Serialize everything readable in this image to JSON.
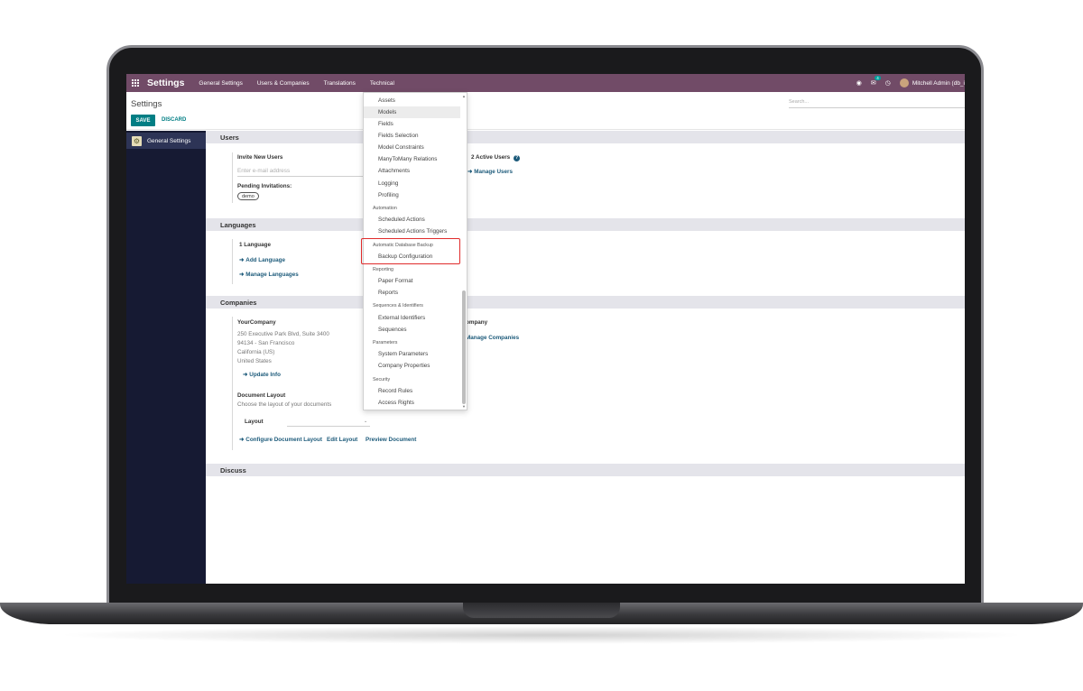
{
  "navbar": {
    "brand": "Settings",
    "menu": [
      "General Settings",
      "Users & Companies",
      "Translations",
      "Technical"
    ],
    "chat_badge": "4",
    "user": "Mitchell Admin (db_i"
  },
  "control": {
    "title": "Settings",
    "save": "SAVE",
    "discard": "DISCARD",
    "search_placeholder": "Search..."
  },
  "sidebar": {
    "items": [
      {
        "label": "General Settings"
      }
    ]
  },
  "sections": {
    "users": "Users",
    "languages": "Languages",
    "companies": "Companies",
    "discuss": "Discuss"
  },
  "users": {
    "invite_label": "Invite New Users",
    "email_placeholder": "Enter e-mail address",
    "pending_label": "Pending Invitations:",
    "pending_tag": "demo",
    "active_users": "2 Active Users",
    "manage_users": "Manage Users"
  },
  "languages": {
    "count": "1 Language",
    "add": "Add Language",
    "manage": "Manage Languages"
  },
  "companies": {
    "name": "YourCompany",
    "address": [
      "250 Executive Park Blvd, Suite 3400",
      "94134 - San Francisco",
      "California (US)",
      "United States"
    ],
    "update": "Update Info",
    "doc_layout_title": "Document Layout",
    "doc_layout_desc": "Choose the layout of your documents",
    "layout_label": "Layout",
    "configure": "Configure Document Layout",
    "edit_layout": "Edit Layout",
    "preview": "Preview Document",
    "company_partial": "ompany",
    "manage_companies": "Manage Companies"
  },
  "dropdown": {
    "items_top": [
      "Assets",
      "Models",
      "Fields",
      "Fields Selection",
      "Model Constraints",
      "ManyToMany Relations",
      "Attachments",
      "Logging",
      "Profiling"
    ],
    "automation_header": "Automation",
    "automation_items": [
      "Scheduled Actions",
      "Scheduled Actions Triggers"
    ],
    "backup_header": "Automatic Database Backup",
    "backup_items": [
      "Backup Configuration"
    ],
    "reporting_header": "Reporting",
    "reporting_items": [
      "Paper Format",
      "Reports"
    ],
    "seq_header": "Sequences & Identifiers",
    "seq_items": [
      "External Identifiers",
      "Sequences"
    ],
    "params_header": "Parameters",
    "params_items": [
      "System Parameters",
      "Company Properties"
    ],
    "security_header": "Security",
    "security_items": [
      "Record Rules",
      "Access Rights"
    ]
  },
  "colors": {
    "navbar": "#714b67",
    "primary": "#017e84",
    "sidebar": "#161a33",
    "highlight": "#e02b2b"
  }
}
